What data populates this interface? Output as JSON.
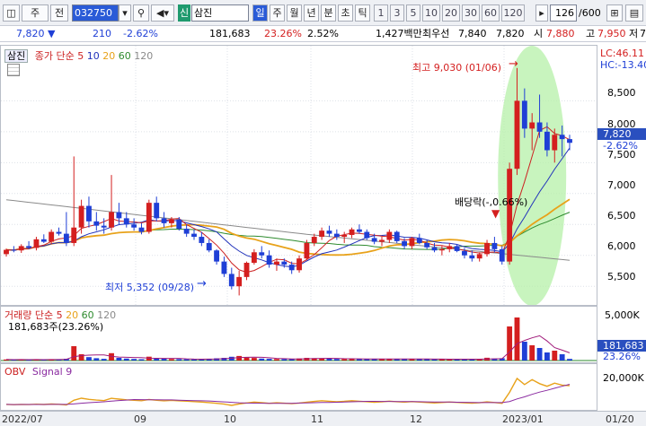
{
  "toolbar": {
    "code": "032750",
    "stock_tag": "신",
    "stock_name": "삼진",
    "periods": [
      "일",
      "주",
      "월",
      "년",
      "분",
      "초",
      "틱"
    ],
    "minutes": [
      "1",
      "3",
      "5",
      "10",
      "20",
      "30",
      "60",
      "120"
    ],
    "count": "126",
    "total": "/600",
    "btn_main": "주",
    "btn_prev": "전"
  },
  "quote": {
    "price": "7,820",
    "change": "210",
    "pct": "-2.62%",
    "volume": "181,683",
    "turnover": "23.26%",
    "ratio": "2.52%",
    "amount": "1,427백만",
    "best_label": "최우선",
    "best_ask": "7,840",
    "best_bid": "7,820",
    "open_label": "시",
    "open": "7,880",
    "high_label": "고",
    "high": "7,950",
    "low_label": "저",
    "low_suffix": "7"
  },
  "price_panel": {
    "name": "삼진",
    "legend": "종가 단순",
    "ma": [
      "5",
      "10",
      "20",
      "60",
      "120"
    ],
    "max_label": "최고 9,030 (01/06)",
    "min_label": "최저 5,352 (09/28)",
    "dividend_label": "배당락(-,0.66%)",
    "lc": "LC:46.11",
    "hc": "HC:-13.40",
    "ticks": [
      "8,500",
      "8,000",
      "7,500",
      "7,000",
      "6,500",
      "6,000",
      "5,500"
    ],
    "current": "7,820",
    "current_pct": "-2.62%"
  },
  "volume_panel": {
    "legend": "거래량 단순",
    "ma": [
      "5",
      "20",
      "60",
      "120"
    ],
    "info": "181,683주(23.26%)",
    "ticks": [
      "5,000K"
    ],
    "current": "181,683",
    "current_pct": "23.26%"
  },
  "obv_panel": {
    "legend": "OBV",
    "signal": "Signal 9",
    "ticks": [
      "20,000K"
    ]
  },
  "xaxis": [
    "2022/07",
    "09",
    "10",
    "11",
    "12",
    "2023/01",
    "01/20"
  ],
  "colors": {
    "up": "#d41f1f",
    "down": "#1f3fd6",
    "ma5": "#cc2222",
    "ma10": "#2233bb",
    "ma20": "#e8a21a",
    "ma60": "#2e8b2e",
    "ma120": "#8a8a8a"
  },
  "chart_data": {
    "type": "candlestick",
    "price_range": [
      5300,
      9100
    ],
    "candles": [
      [
        6020,
        6110,
        5980,
        6090
      ],
      [
        6090,
        6150,
        6050,
        6080
      ],
      [
        6080,
        6180,
        6040,
        6150
      ],
      [
        6150,
        6230,
        6100,
        6120
      ],
      [
        6120,
        6300,
        6080,
        6260
      ],
      [
        6260,
        6340,
        6200,
        6220
      ],
      [
        6220,
        6420,
        6180,
        6380
      ],
      [
        6380,
        6450,
        6320,
        6350
      ],
      [
        6350,
        6700,
        6150,
        6200
      ],
      [
        6200,
        7600,
        6150,
        6450
      ],
      [
        6450,
        6900,
        6350,
        6800
      ],
      [
        6800,
        6950,
        6450,
        6550
      ],
      [
        6550,
        6700,
        6400,
        6480
      ],
      [
        6480,
        6600,
        6350,
        6450
      ],
      [
        6450,
        7300,
        6400,
        6700
      ],
      [
        6700,
        6850,
        6500,
        6600
      ],
      [
        6600,
        6700,
        6450,
        6500
      ],
      [
        6500,
        6600,
        6400,
        6450
      ],
      [
        6450,
        6520,
        6340,
        6380
      ],
      [
        6380,
        6900,
        6350,
        6850
      ],
      [
        6850,
        6950,
        6550,
        6600
      ],
      [
        6600,
        6700,
        6450,
        6520
      ],
      [
        6520,
        6620,
        6450,
        6580
      ],
      [
        6580,
        6620,
        6400,
        6430
      ],
      [
        6430,
        6500,
        6300,
        6350
      ],
      [
        6350,
        6420,
        6250,
        6300
      ],
      [
        6300,
        6380,
        6150,
        6200
      ],
      [
        6200,
        6260,
        6050,
        6080
      ],
      [
        6080,
        6100,
        5850,
        5900
      ],
      [
        5900,
        5980,
        5650,
        5700
      ],
      [
        5700,
        5800,
        5450,
        5500
      ],
      [
        5500,
        5750,
        5352,
        5650
      ],
      [
        5650,
        5900,
        5600,
        5880
      ],
      [
        5880,
        6100,
        5850,
        6050
      ],
      [
        6050,
        6150,
        5950,
        6000
      ],
      [
        6000,
        6080,
        5800,
        5850
      ],
      [
        5850,
        5950,
        5750,
        5900
      ],
      [
        5900,
        5950,
        5800,
        5850
      ],
      [
        5850,
        5900,
        5700,
        5760
      ],
      [
        5760,
        6000,
        5720,
        5950
      ],
      [
        5950,
        6250,
        5920,
        6200
      ],
      [
        6200,
        6350,
        6150,
        6300
      ],
      [
        6300,
        6450,
        6250,
        6400
      ],
      [
        6400,
        6480,
        6300,
        6350
      ],
      [
        6350,
        6420,
        6250,
        6300
      ],
      [
        6300,
        6380,
        6200,
        6330
      ],
      [
        6330,
        6450,
        6280,
        6420
      ],
      [
        6420,
        6500,
        6350,
        6380
      ],
      [
        6380,
        6420,
        6250,
        6280
      ],
      [
        6280,
        6350,
        6180,
        6220
      ],
      [
        6220,
        6300,
        6150,
        6250
      ],
      [
        6250,
        6420,
        6200,
        6380
      ],
      [
        6380,
        6400,
        6200,
        6230
      ],
      [
        6230,
        6280,
        6100,
        6150
      ],
      [
        6150,
        6300,
        6100,
        6280
      ],
      [
        6280,
        6350,
        6180,
        6200
      ],
      [
        6200,
        6250,
        6100,
        6130
      ],
      [
        6130,
        6200,
        6050,
        6080
      ],
      [
        6080,
        6150,
        6000,
        6100
      ],
      [
        6100,
        6200,
        6050,
        6150
      ],
      [
        6150,
        6180,
        6050,
        6070
      ],
      [
        6070,
        6120,
        5950,
        6000
      ],
      [
        6000,
        6080,
        5900,
        5950
      ],
      [
        5950,
        6050,
        5900,
        6020
      ],
      [
        6020,
        6250,
        5980,
        6200
      ],
      [
        6200,
        6300,
        6050,
        6100
      ],
      [
        6100,
        6150,
        5850,
        5900
      ],
      [
        5900,
        7500,
        5850,
        7400
      ],
      [
        7400,
        9030,
        7300,
        8500
      ],
      [
        8500,
        8700,
        7900,
        8050
      ],
      [
        8050,
        8300,
        7700,
        8150
      ],
      [
        8150,
        8600,
        7900,
        8000
      ],
      [
        8000,
        8150,
        7600,
        7700
      ],
      [
        7700,
        8050,
        7500,
        7950
      ],
      [
        7950,
        8100,
        7600,
        7880
      ],
      [
        7880,
        7950,
        7700,
        7820
      ]
    ],
    "volume_k": [
      120,
      90,
      110,
      80,
      140,
      95,
      150,
      100,
      200,
      1600,
      700,
      380,
      260,
      190,
      820,
      300,
      220,
      180,
      150,
      430,
      260,
      200,
      170,
      160,
      140,
      130,
      160,
      190,
      250,
      300,
      420,
      510,
      340,
      290,
      220,
      190,
      170,
      160,
      150,
      230,
      300,
      260,
      240,
      200,
      180,
      170,
      210,
      190,
      170,
      160,
      150,
      200,
      170,
      160,
      190,
      170,
      150,
      140,
      150,
      160,
      150,
      140,
      130,
      150,
      310,
      220,
      260,
      3800,
      4800,
      2100,
      1700,
      1400,
      900,
      1100,
      700,
      181
    ],
    "series": [
      {
        "name": "OBV"
      },
      {
        "name": "Signal 9"
      }
    ]
  }
}
